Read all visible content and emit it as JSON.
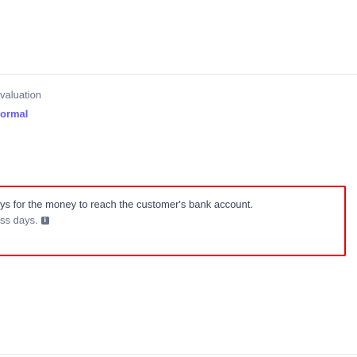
{
  "evaluation": {
    "label": "valuation",
    "value": "ormal"
  },
  "payout_info": {
    "description": "ys for the money to reach the customer's bank account.",
    "days_text": "ss days.",
    "info_icon_glyph": "i"
  },
  "colors": {
    "link": "#635bff",
    "highlight": "#ee0000",
    "muted_text": "#697386",
    "body_text": "#3c4257",
    "divider": "#e3e8ee"
  }
}
